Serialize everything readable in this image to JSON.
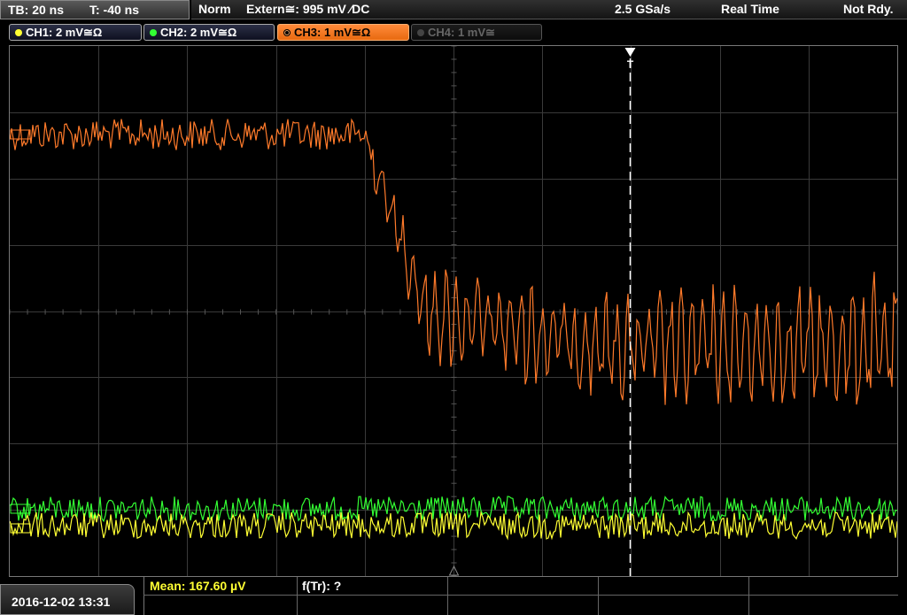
{
  "status": {
    "timebase": "TB: 20 ns",
    "trigger_offset": "T: -40 ns",
    "mode": "Norm",
    "trigger_source": "Extern≅: 995 mV ⁄DC",
    "sample_rate": "2.5 GSa/s",
    "acq_mode": "Real Time",
    "state": "Not Rdy."
  },
  "channels": [
    {
      "label": "CH1: 2 mV≅Ω",
      "color": "#ffff33",
      "active": false,
      "enabled": true
    },
    {
      "label": "CH2: 2 mV≅Ω",
      "color": "#33ff33",
      "active": false,
      "enabled": true
    },
    {
      "label": "CH3: 1 mV≅Ω",
      "color": "#ff8c3c",
      "active": true,
      "enabled": true
    },
    {
      "label": "CH4: 1 mV≅",
      "color": "#666666",
      "active": false,
      "enabled": false
    }
  ],
  "trigger_marker": "T",
  "bottom": {
    "datetime": "2016-12-02 13:31",
    "mean": "Mean: 167.60 µV",
    "ftr": "f(Tr): ?"
  },
  "colors": {
    "ch1": "#ffff33",
    "ch2": "#33ff33",
    "ch3": "#ff7a2a",
    "grid": "#3a3a3a"
  }
}
